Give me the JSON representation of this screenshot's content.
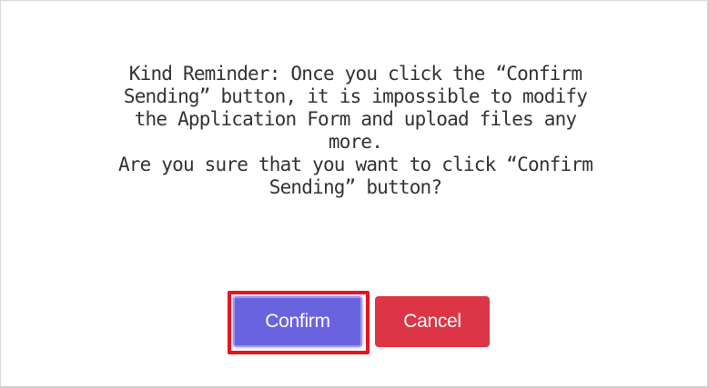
{
  "dialog": {
    "message_lines": [
      "Kind Reminder: Once you click the “Confirm",
      "Sending” button, it is impossible to modify",
      "the Application Form and upload files any",
      "more.",
      "Are you sure that you want to click “Confirm",
      "Sending” button?"
    ],
    "confirm_label": "Confirm",
    "cancel_label": "Cancel"
  },
  "colors": {
    "confirm_button": "#6a63e0",
    "cancel_button": "#dc3545",
    "focus_highlight": "#e8141b"
  }
}
